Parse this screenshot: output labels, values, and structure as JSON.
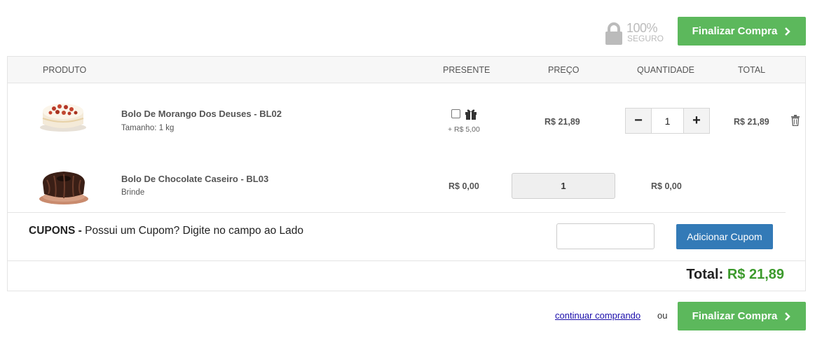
{
  "security": {
    "percent": "100%",
    "label": "SEGURO",
    "icon": "lock-icon"
  },
  "checkout_label": "Finalizar Compra",
  "table": {
    "headers": {
      "produto": "PRODUTO",
      "presente": "PRESENTE",
      "preco": "PREÇO",
      "quantidade": "QUANTIDADE",
      "total": "TOTAL"
    },
    "items": [
      {
        "name": "Bolo De Morango Dos Deuses - BL02",
        "sub": "Tamanho: 1 kg",
        "gift_extra": "+ R$ 5,00",
        "price": "R$ 21,89",
        "qty": "1",
        "total": "R$ 21,89",
        "icon": "strawberry-cake-image"
      },
      {
        "name": "Bolo De Chocolate Caseiro - BL03",
        "sub": "Brinde",
        "gift_price": "R$ 0,00",
        "qty": "1",
        "total": "R$ 0,00",
        "icon": "chocolate-cake-image"
      }
    ]
  },
  "coupon": {
    "title": "CUPONS -",
    "text": "Possui um Cupom? Digite no campo ao Lado",
    "input_value": "",
    "button": "Adicionar Cupom"
  },
  "summary": {
    "total_label": "Total:",
    "total_value": "R$ 21,89"
  },
  "footer": {
    "continue": "continuar comprando",
    "or": "ou"
  },
  "colors": {
    "green": "#5cb85c",
    "blue": "#337ab7",
    "total_green": "#3c9a2c"
  }
}
